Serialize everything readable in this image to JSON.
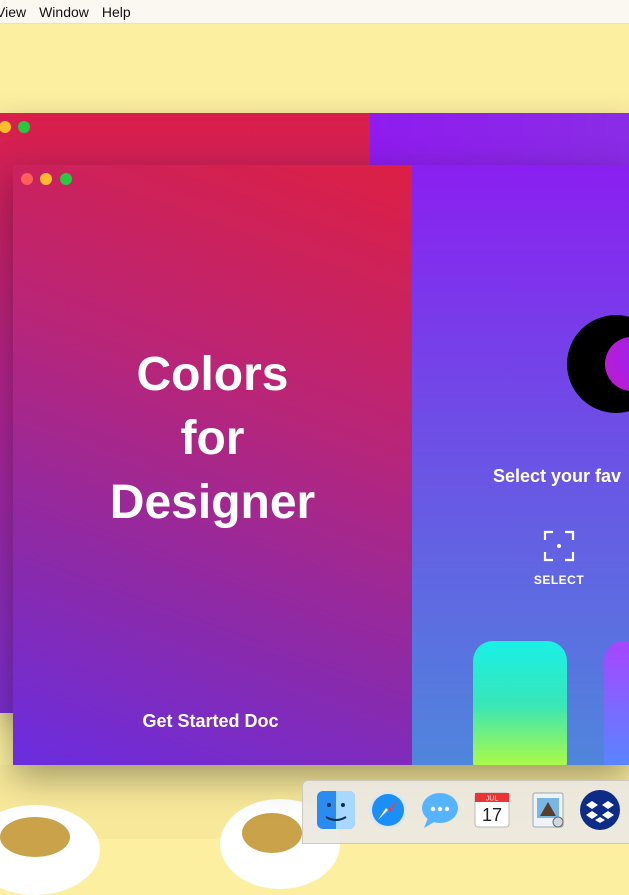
{
  "menubar": {
    "items": [
      "View",
      "Window",
      "Help"
    ]
  },
  "app": {
    "title_lines": [
      "Colors",
      "for",
      "Designer"
    ],
    "get_started": "Get Started Doc",
    "select_heading": "Select your fav",
    "select_label": "SELECT"
  },
  "colors": {
    "close": "#fe5f57",
    "minimize": "#febc2e",
    "zoom": "#28c840"
  },
  "dock": {
    "icons": [
      "finder-icon",
      "safari-icon",
      "messages-icon",
      "calendar-icon",
      "preview-icon",
      "dropbox-icon"
    ],
    "calendar": {
      "month": "JUL",
      "day": "17"
    }
  }
}
